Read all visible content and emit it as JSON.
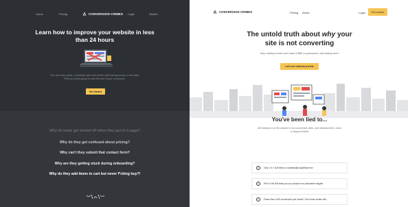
{
  "left": {
    "nav": {
      "links": [
        "Home",
        "Pricing",
        "Login",
        "Stories"
      ],
      "logo_text": "CONVERSION CRIMES"
    },
    "hero_title": "Learn how to improve your website in less than 24 hours",
    "subtitle": "Your site looks great, it probably does well; there's still leaving money on the table. Find out whats going on with the rest of your conversion.",
    "cta_label": "Get started",
    "questions": [
      "Why do leads get turned off when they get to it page?",
      "Why do they get confused about pricing?",
      "Why can't they submit that contact form?",
      "Why are they getting stuck during onboarding?",
      "Why do they add items to cart but never f*cking buy?!"
    ],
    "colors": {
      "bg_top": "#2c3035",
      "bg_bottom": "#33373c",
      "accent": "#f6c453"
    }
  },
  "right": {
    "nav": {
      "logo_text": "CONVERSION CRIMES",
      "links": [
        "Pricing",
        "About"
      ],
      "login_label": "Login",
      "cta_label": "Get started"
    },
    "title_line1": "The untold truth about ",
    "title_em": "why",
    "title_line1_end": " your",
    "title_line2": "site is not converting",
    "subtitle": "Stop wasting months and loads of $$$ on guesswork, start asking users",
    "cta_label": "Let's see what they think",
    "section_title": "You've been lied to...",
    "section_sub": "A/B testing is not the answer to low conversion rates, cart abandonment, churn or support tickets",
    "facts": [
      "Only 1 in 7 A/B tests is a statistically significant win",
      "90% of the A/B tests you run produce non-actionable insights",
      "Fewer than 1000 conversions per month? You'd learn better with..."
    ],
    "colors": {
      "accent": "#f6c453",
      "text": "#262626"
    }
  }
}
